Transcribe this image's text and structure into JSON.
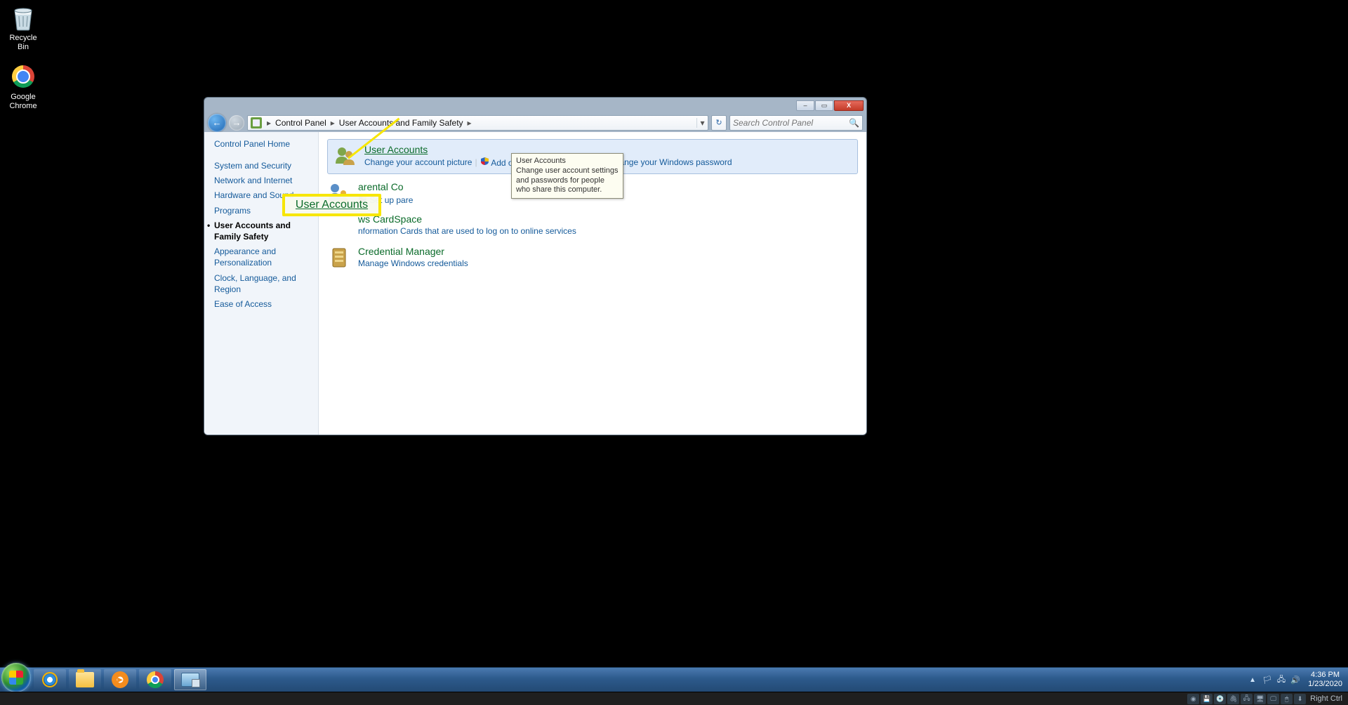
{
  "desktop_icons": {
    "recycle_bin": "Recycle Bin",
    "google_chrome": "Google\nChrome"
  },
  "window": {
    "titlebar": {
      "min": "–",
      "max": "▭",
      "close": "X"
    },
    "breadcrumbs": {
      "root_icon_name": "user-accounts-icon",
      "root": "Control Panel",
      "sub": "User Accounts and Family Safety"
    },
    "refresh_label": "↻",
    "search_placeholder": "Search Control Panel"
  },
  "sidebar": {
    "home": "Control Panel Home",
    "links": [
      "System and Security",
      "Network and Internet",
      "Hardware and Sound",
      "Programs",
      "User Accounts and Family Safety",
      "Appearance and Personalization",
      "Clock, Language, and Region",
      "Ease of Access"
    ]
  },
  "categories": {
    "user_accounts": {
      "title": "User Accounts",
      "subs": [
        "Change your account picture",
        "Add or remove user accounts",
        "Change your Windows password"
      ]
    },
    "parental_controls": {
      "title_visible": "arental Co",
      "subs": [
        "Set up pare"
      ]
    },
    "cardspace": {
      "title_visible": "ws CardSpace",
      "sub": "nformation Cards that are used to log on to online services"
    },
    "cred_mgr": {
      "title": "Credential Manager",
      "sub": "Manage Windows credentials"
    }
  },
  "tooltip": {
    "title": "User Accounts",
    "body": "Change user account settings and passwords for people who share this computer."
  },
  "callout": {
    "label": "User Accounts"
  },
  "systray": {
    "time": "4:36 PM",
    "date": "1/23/2020",
    "flag": "🏳",
    "net": "🖧",
    "vol": "🔊"
  },
  "vmbar": {
    "right_ctrl": "Right Ctrl"
  }
}
